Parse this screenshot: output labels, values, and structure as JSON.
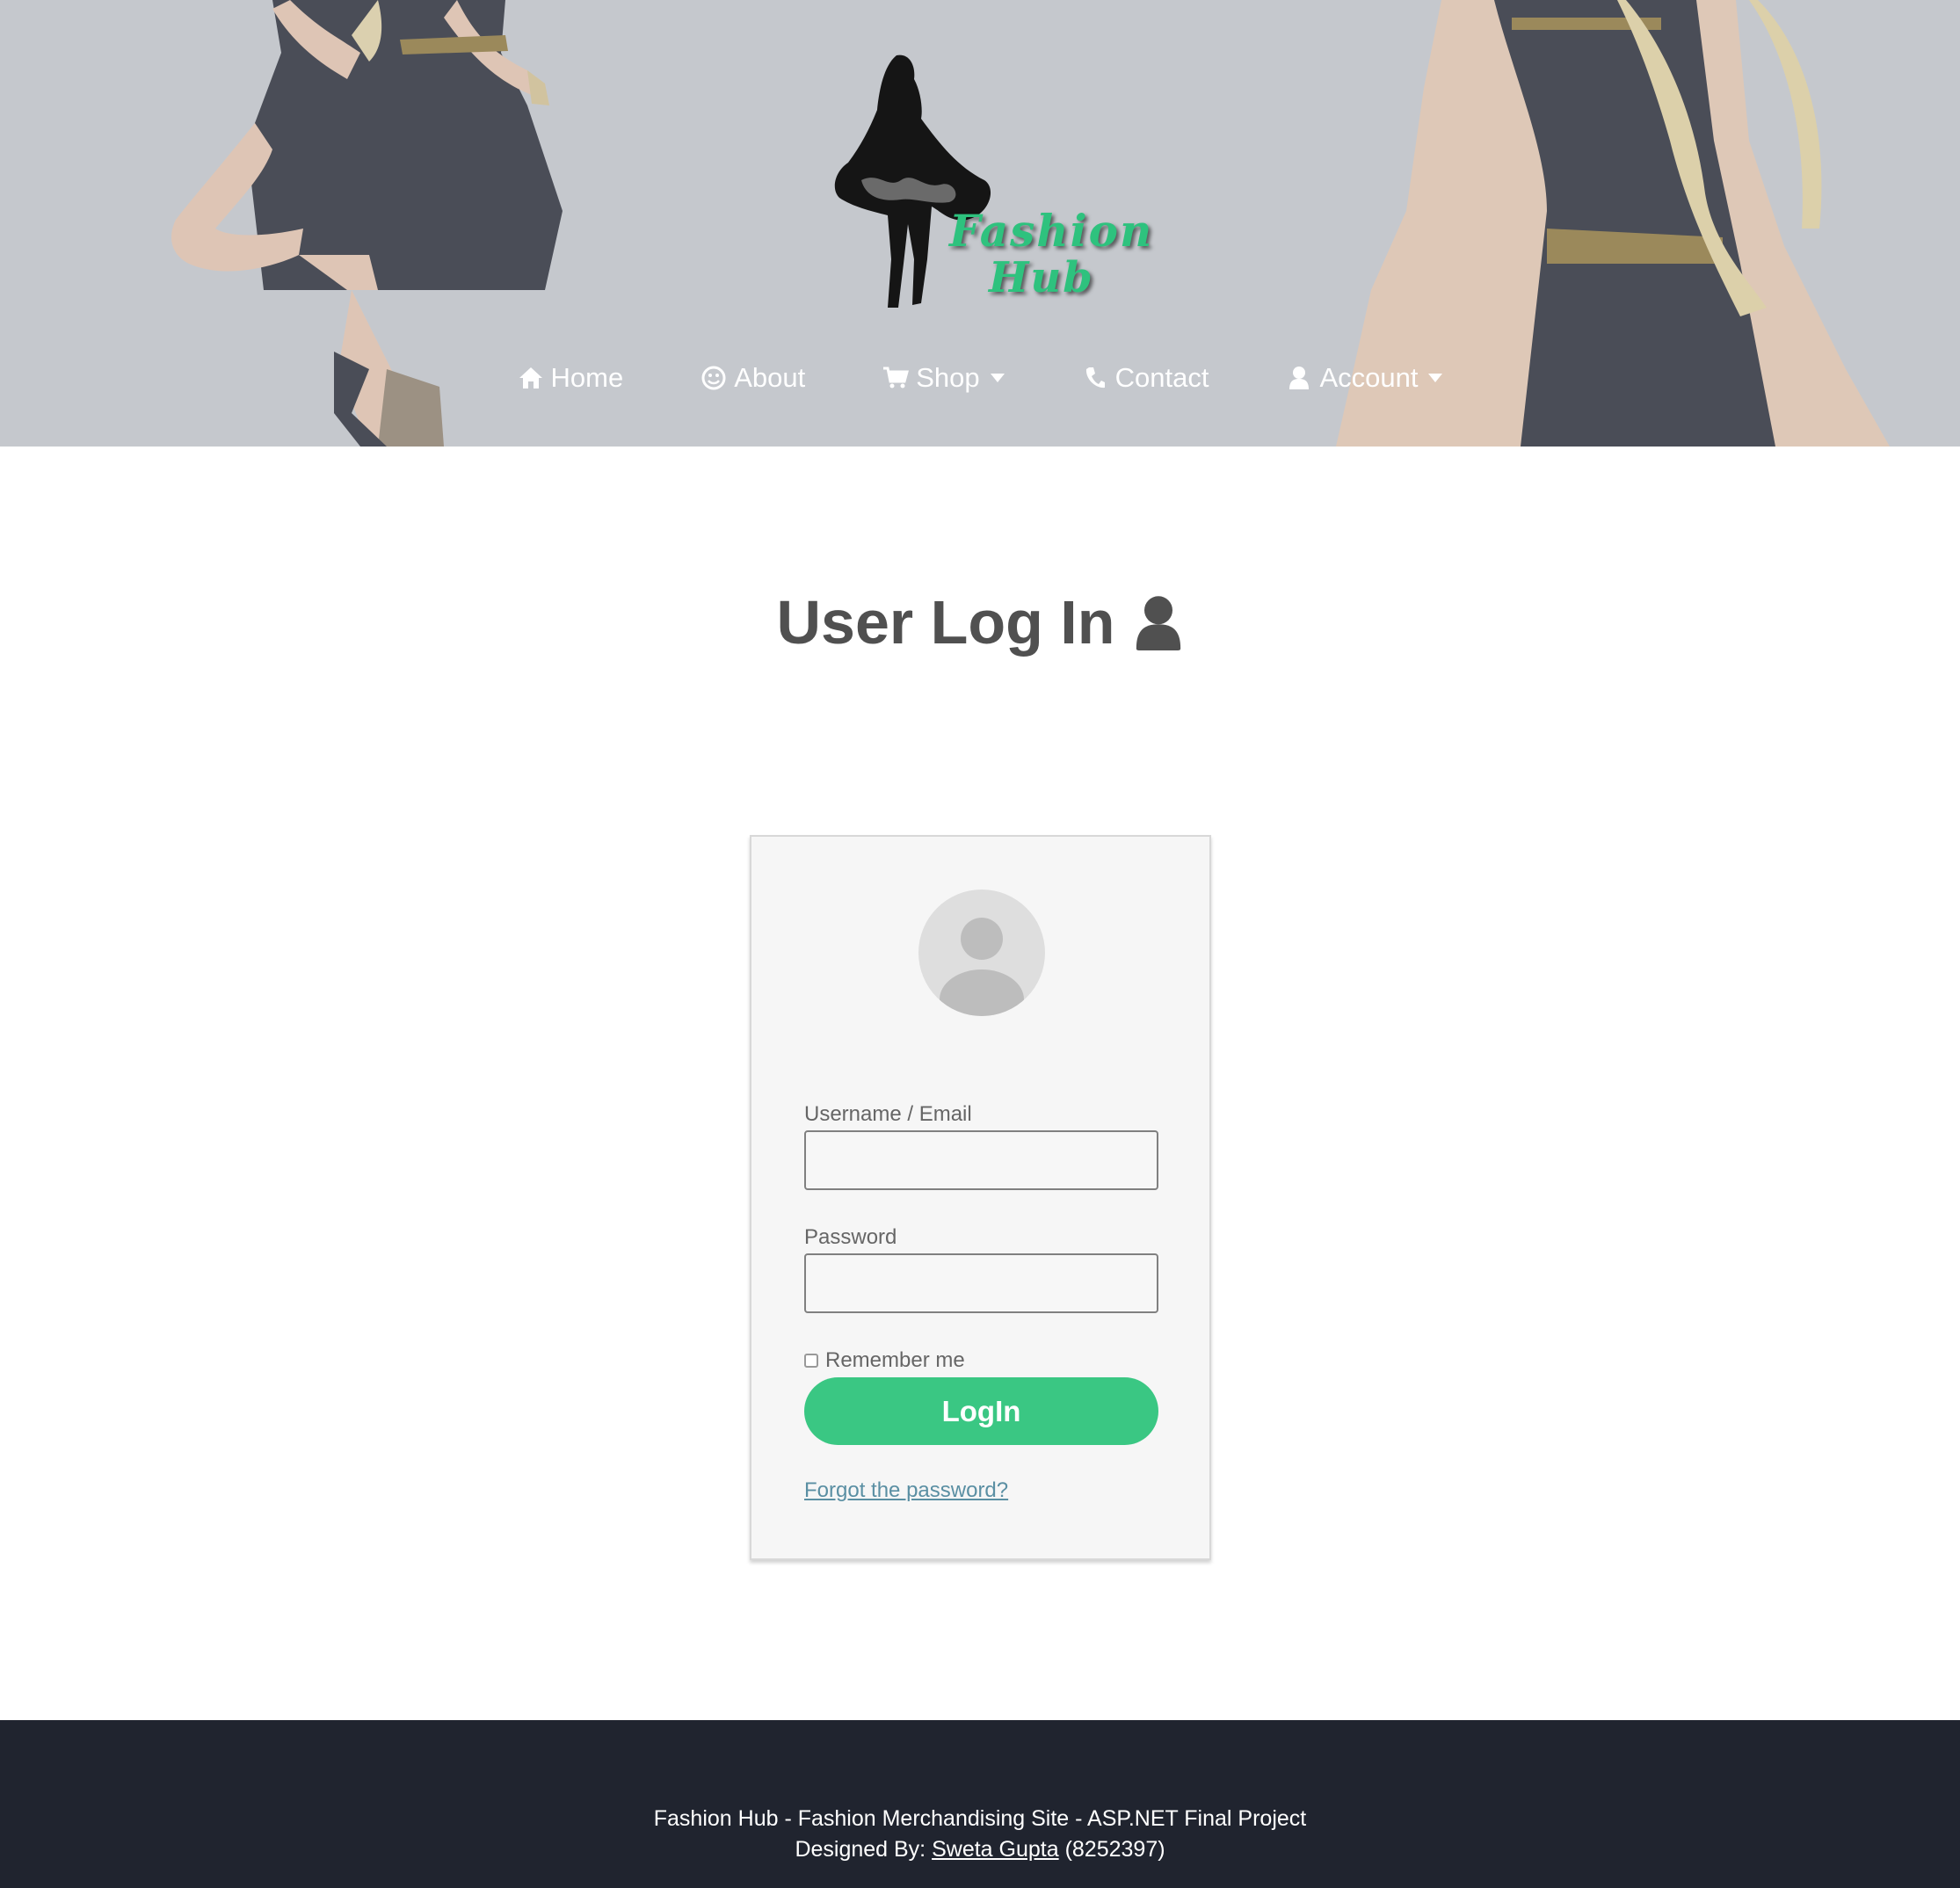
{
  "brand": {
    "logo_line1": "Fashion",
    "logo_line2": "Hub",
    "accent_color": "#2ec27e"
  },
  "nav": {
    "items": [
      {
        "label": "Home",
        "icon": "home-icon"
      },
      {
        "label": "About",
        "icon": "smile-icon"
      },
      {
        "label": "Shop",
        "icon": "cart-icon",
        "dropdown": true
      },
      {
        "label": "Contact",
        "icon": "phone-icon"
      },
      {
        "label": "Account",
        "icon": "user-icon",
        "dropdown": true
      }
    ]
  },
  "main": {
    "title": "User Log In",
    "title_icon": "user-icon"
  },
  "login": {
    "avatar_icon": "avatar-placeholder-icon",
    "username_label": "Username / Email",
    "username_value": "",
    "password_label": "Password",
    "password_value": "",
    "remember_label": "Remember me",
    "remember_checked": false,
    "button_label": "LogIn",
    "button_color": "#3ac783",
    "forgot_link": "Forgot the password?"
  },
  "footer": {
    "line1": "Fashion Hub - Fashion Merchandising Site - ASP.NET Final Project",
    "designed_by_prefix": "Designed By:",
    "designer_name": "Sweta Gupta",
    "designer_id": "(8252397)",
    "background": "#20242f"
  }
}
